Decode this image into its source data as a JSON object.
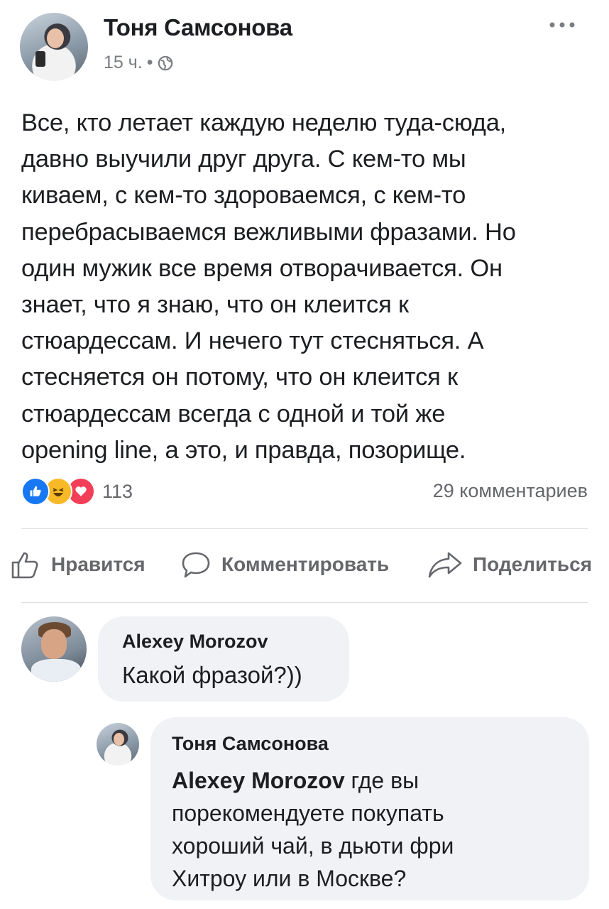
{
  "post": {
    "author": "Тоня Самсонова",
    "time": "15 ч.",
    "separator": "•",
    "privacy_icon": "globe-icon",
    "more_icon": "more-icon",
    "text_lines": [
      "Все, кто летает каждую неделю туда-сюда,",
      "давно выучили друг друга. С кем-то мы",
      "киваем, с кем-то здороваемся, с кем-то",
      "перебрасываемся вежливыми фразами. Но",
      "один мужик все время отворачивается. Он",
      "знает, что я знаю, что он клеится к",
      "стюардессам. И нечего тут стесняться. А",
      "стесняется он потому, что он клеится к",
      "стюардессам всегда с одной и той же",
      "opening line, а это, и правда, позорище."
    ]
  },
  "stats": {
    "reactions": [
      "like-icon",
      "haha-icon",
      "love-icon"
    ],
    "reaction_count": "113",
    "comments_count": "29 комментариев"
  },
  "actions": {
    "like": "Нравится",
    "comment": "Комментировать",
    "share": "Поделиться"
  },
  "comments": [
    {
      "author": "Alexey Morozov",
      "text": "Какой фразой?))"
    },
    {
      "author": "Тоня Самсонова",
      "mention": "Alexey Morozov",
      "text_lines": [
        " где вы",
        "порекомендуете покупать",
        "хороший чай, в дьюти фри",
        "Хитроу или в Москве?"
      ]
    }
  ],
  "colors": {
    "text": "#1c1e21",
    "secondary": "#65676b",
    "bubble": "#f0f2f5",
    "divider": "#dadde1",
    "like_blue": "#1877f2",
    "haha_yellow": "#f7b928",
    "love_red": "#f33e58"
  }
}
